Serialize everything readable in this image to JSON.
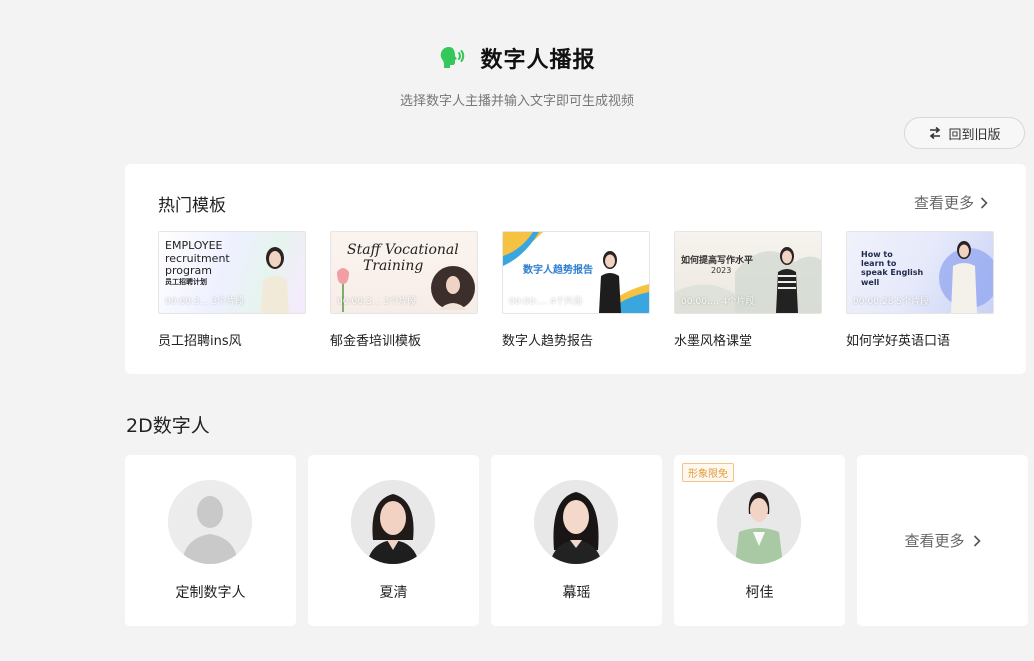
{
  "header": {
    "title": "数字人播报",
    "subtitle": "选择数字人主播并输入文字即可生成视频",
    "back_label": "回到旧版",
    "accent_color": "#34c759"
  },
  "hot_templates": {
    "title": "热门模板",
    "more_label": "查看更多",
    "items": [
      {
        "name": "员工招聘ins风",
        "thumb_lines": [
          "EMPLOYEE",
          "recruitment",
          "program",
          "员工招聘计划"
        ],
        "duration": "00:00:3… 3个片段"
      },
      {
        "name": "郁金香培训模板",
        "thumb_lines": [
          "Staff Vocational",
          "Training"
        ],
        "duration": "00:00:3… 3个片段"
      },
      {
        "name": "数字人趋势报告",
        "thumb_lines": [
          "数字人趋势报告"
        ],
        "duration": "00:00:… 4个片段"
      },
      {
        "name": "水墨风格课堂",
        "thumb_lines": [
          "如何提高写作水平",
          "2023"
        ],
        "duration": "00:00:… 4个片段"
      },
      {
        "name": "如何学好英语口语",
        "thumb_lines": [
          "How to",
          "learn to",
          "speak English",
          "well"
        ],
        "duration": "00:00:28 5个片段"
      }
    ]
  },
  "avatars_section": {
    "title": "2D数字人",
    "items": [
      {
        "name": "定制数字人",
        "badge": ""
      },
      {
        "name": "夏清",
        "badge": ""
      },
      {
        "name": "幕瑶",
        "badge": ""
      },
      {
        "name": "柯佳",
        "badge": "形象限免"
      }
    ],
    "more_label": "查看更多"
  }
}
